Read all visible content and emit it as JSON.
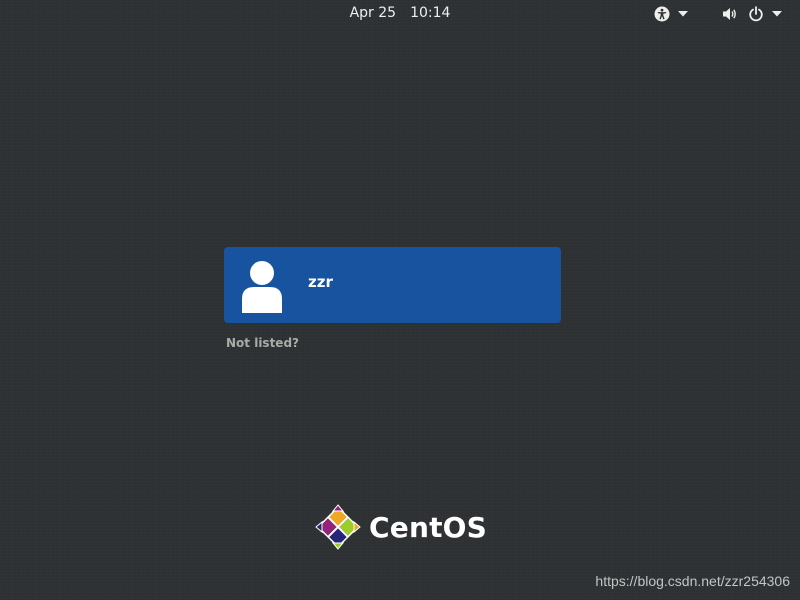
{
  "top_bar": {
    "date": "Apr 25",
    "time": "10:14"
  },
  "icons": {
    "accessibility": "accessibility-icon",
    "volume": "volume-icon",
    "power": "power-icon",
    "dropdown": "chevron-down-icon"
  },
  "user_list": {
    "users": [
      {
        "name": "zzr"
      }
    ],
    "not_listed_label": "Not listed?"
  },
  "branding": {
    "logo_text": "CentOS"
  },
  "watermark": "https://blog.csdn.net/zzr254306",
  "colors": {
    "background": "#2e3133",
    "user_card": "#1853a0",
    "text": "#eeeeec",
    "muted_text": "#a9aca6"
  }
}
